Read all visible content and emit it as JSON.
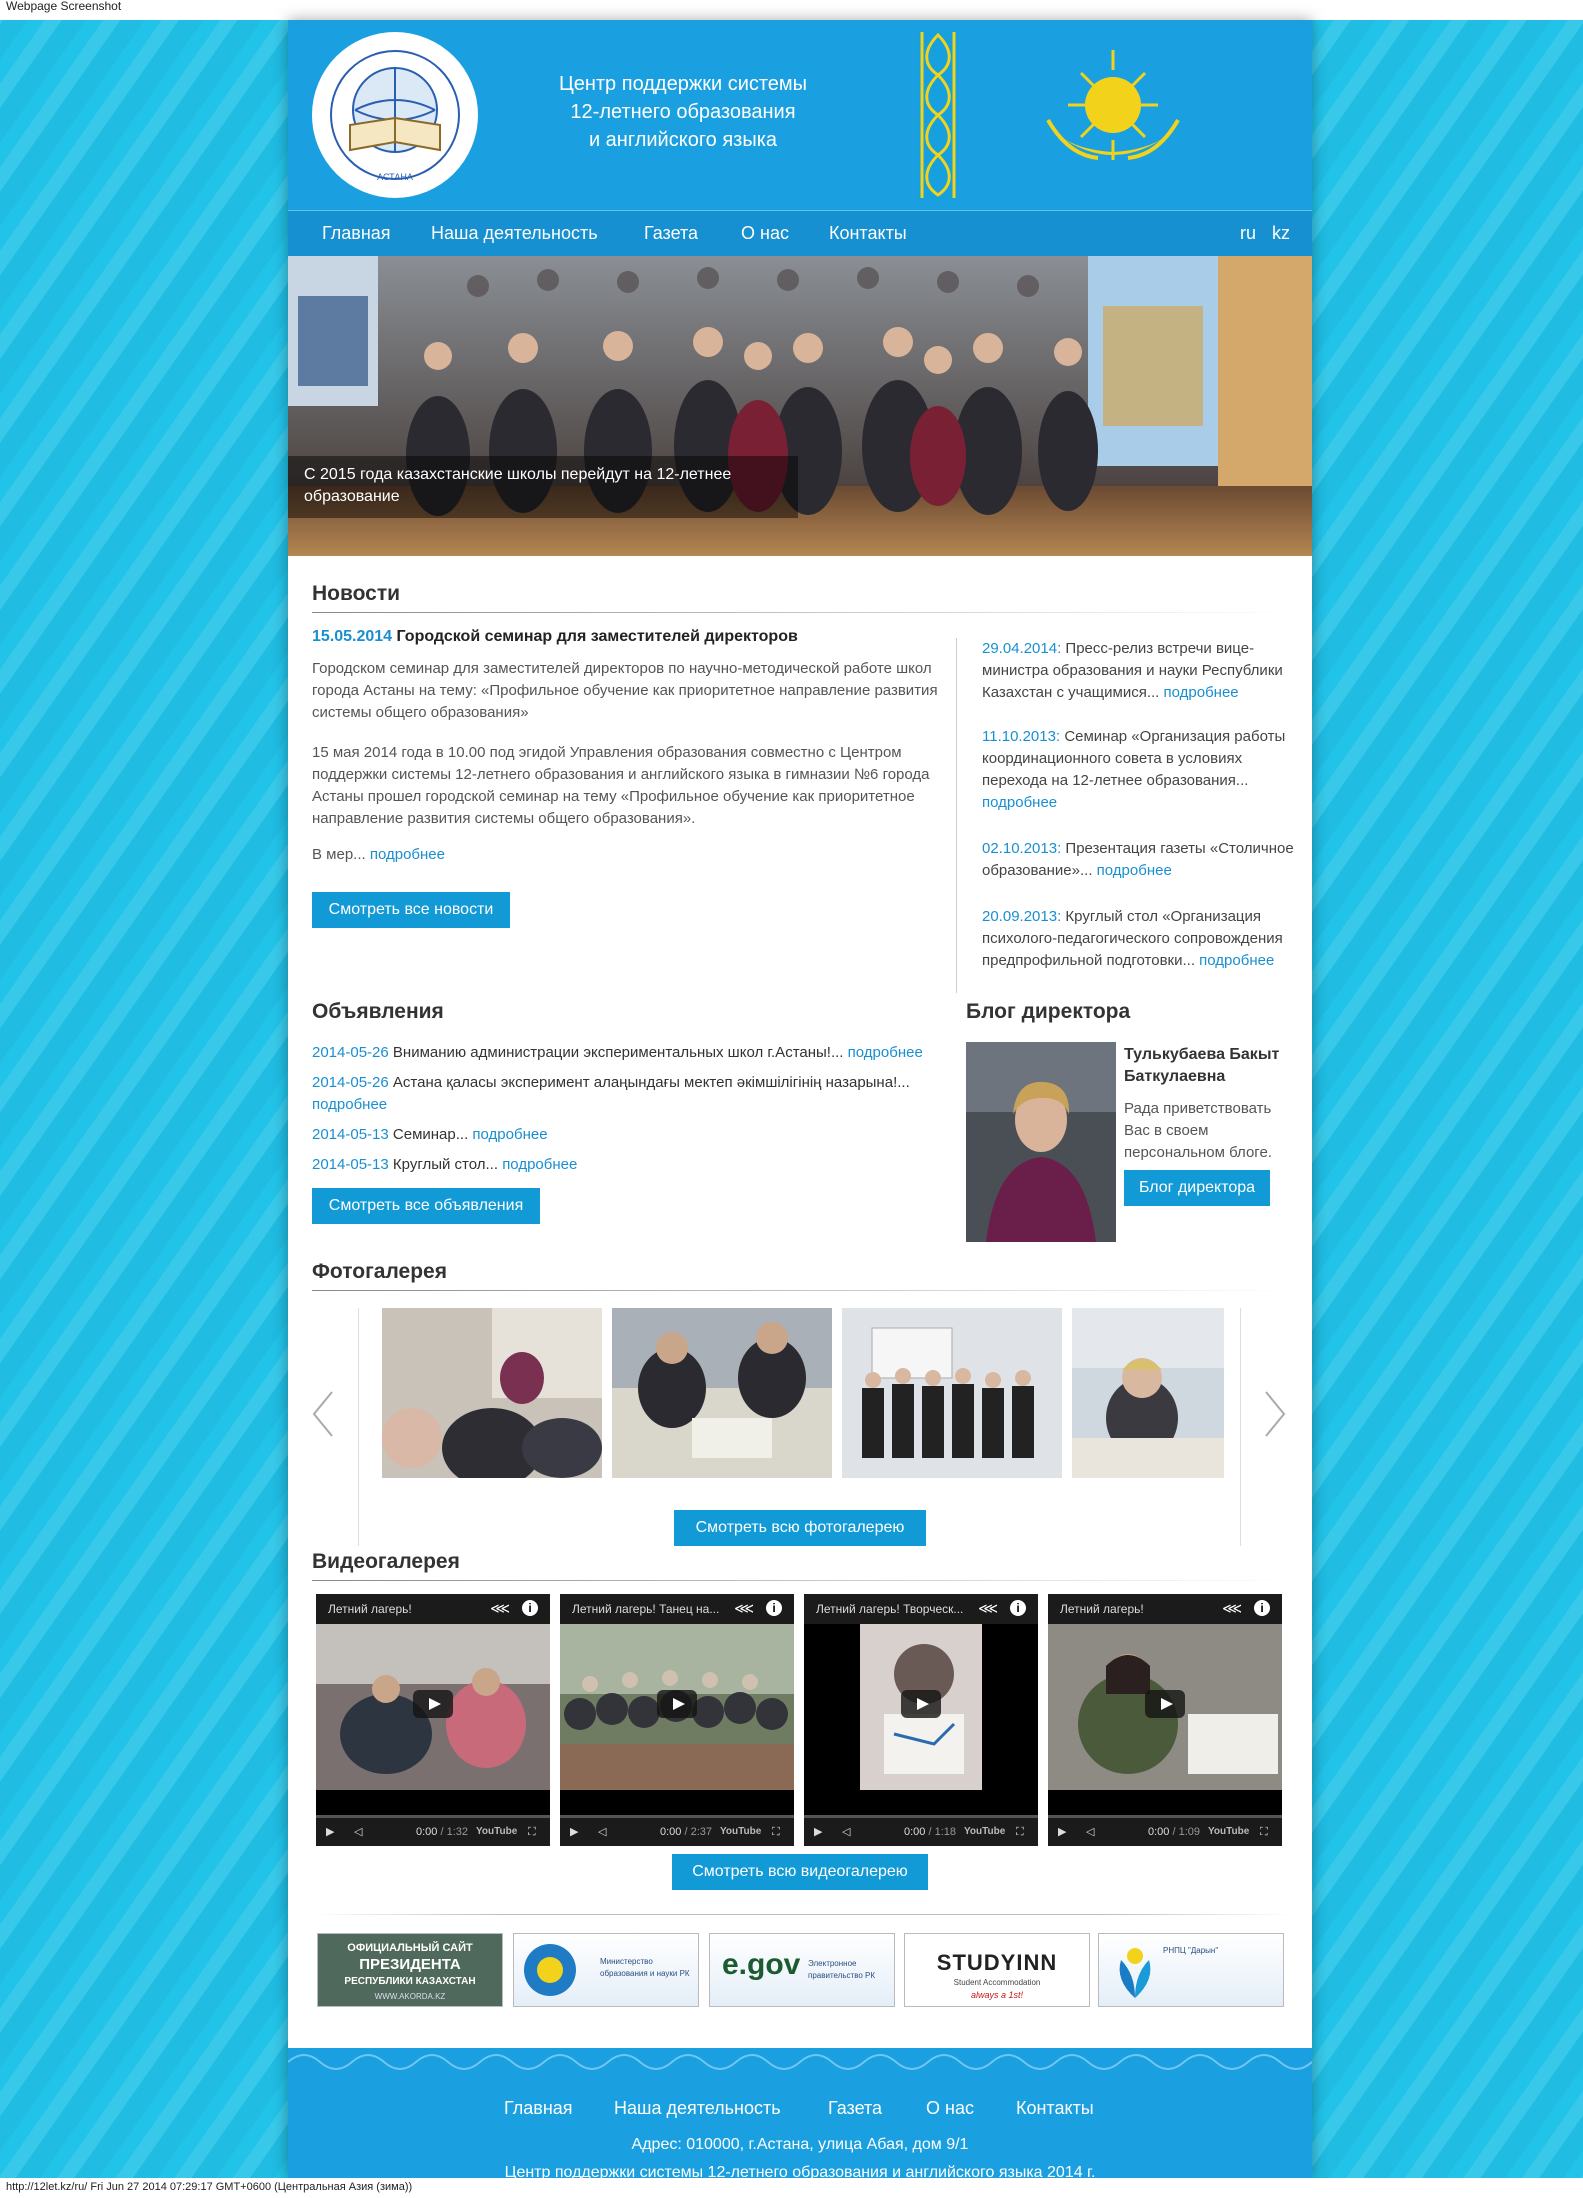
{
  "window": {
    "caption": "Webpage Screenshot",
    "status": "http://12let.kz/ru/ Fri Jun 27 2014 07:29:17 GMT+0600 (Центральная Азия (зима))"
  },
  "header": {
    "title_line1": "Центр поддержки системы",
    "title_line2": "12-летнего образования",
    "title_line3": "и английского языка",
    "logo_icon": "book-globe-logo-icon",
    "emblem_icon": "kazakhstan-emblem-icon"
  },
  "nav": {
    "items": [
      "Главная",
      "Наша деятельность",
      "Газета",
      "О нас",
      "Контакты"
    ],
    "lang_ru": "ru",
    "lang_kz": "kz"
  },
  "hero": {
    "caption": "С 2015 года казахстанские школы перейдут на 12-летнее образование"
  },
  "news": {
    "title": "Новости",
    "main": {
      "date": "15.05.2014",
      "headline": "Городской семинар для заместителей директоров",
      "p1": "Городском семинар для заместителей директоров по научно-методической работе школ города Астаны на тему: «Профильное обучение как приоритетное направление развития системы общего образования»",
      "p2": "15 мая 2014 года в 10.00 под эгидой Управления образования совместно с Центром поддержки системы 12-летнего образования и английского языка в гимназии №6 города Астаны прошел городской семинар на тему «Профильное обучение как приоритетное направление развития системы общего образования».",
      "p3": "В мер...",
      "more": "подробнее"
    },
    "all_button": "Смотреть все новости",
    "side": [
      {
        "date": "29.04.2014:",
        "text": "Пресс-релиз встречи вице-министра образования и науки Республики Казахстан с учащимися...",
        "more": "подробнее"
      },
      {
        "date": "11.10.2013:",
        "text": "Семинар «Организация работы координационного совета в условиях перехода на 12-летнее образования...",
        "more": "подробнее"
      },
      {
        "date": "02.10.2013:",
        "text": "Презентация газеты «Столичное образование»...",
        "more": "подробнее"
      },
      {
        "date": "20.09.2013:",
        "text": "Круглый стол «Организация психолого-педагогического сопровождения предпрофильной подготовки...",
        "more": "подробнее"
      }
    ]
  },
  "ads": {
    "title": "Объявления",
    "items": [
      {
        "date": "2014-05-26",
        "text": "Вниманию администрации экспериментальных школ г.Астаны!...",
        "more": "подробнее"
      },
      {
        "date": "2014-05-26",
        "text": "Астана қаласы эксперимент алаңындағы мектеп әкімшілігінің назарына!...",
        "more": "подробнее"
      },
      {
        "date": "2014-05-13",
        "text": "Семинар...",
        "more": "подробнее"
      },
      {
        "date": "2014-05-13",
        "text": "Круглый стол...",
        "more": "подробнее"
      }
    ],
    "all_button": "Смотреть все объявления"
  },
  "blog": {
    "title": "Блог директора",
    "name_line1": "Тулькубаева Бакыт",
    "name_line2": "Баткулаевна",
    "greeting": "Рада приветствовать Вас в своем персональном блоге.",
    "button": "Блог директора"
  },
  "photos": {
    "title": "Фотогалерея",
    "button": "Смотреть всю фотогалерею",
    "prev_icon": "chevron-left-icon",
    "next_icon": "chevron-right-icon"
  },
  "videos": {
    "title": "Видеогалерея",
    "button": "Смотреть всю видеогалерею",
    "items": [
      {
        "title": "Летний лагерь!",
        "time": "0:00",
        "duration": "/ 1:32"
      },
      {
        "title": "Летний лагерь! Танец на...",
        "time": "0:00",
        "duration": "/ 2:37"
      },
      {
        "title": "Летний лагерь! Творческ...",
        "time": "0:00",
        "duration": "/ 1:18"
      },
      {
        "title": "Летний лагерь!",
        "time": "0:00",
        "duration": "/ 1:09"
      }
    ],
    "yt_label": "YouTube"
  },
  "banners": {
    "president_l1": "ОФИЦИАЛЬНЫЙ САЙТ",
    "president_l2": "ПРЕЗИДЕНТА",
    "president_l3": "РЕСПУБЛИКИ КАЗАХСТАН",
    "president_l4": "WWW.AKORDA.KZ",
    "ministry": "Министерство образования и науки РК",
    "egov_logo": "e.gov",
    "egov_text": "Электронное правительство РК",
    "studyinn": "STUDYINN",
    "studyinn_sub": "Student Accommodation",
    "studyinn_tag": "always a 1st!",
    "daryn": "РНПЦ \"Дарын\""
  },
  "footer": {
    "items": [
      "Главная",
      "Наша деятельность",
      "Газета",
      "О нас",
      "Контакты"
    ],
    "address": "Адрес: 010000, г.Астана, улица Абая, дом 9/1",
    "copyright": "Центр поддержки системы 12-летнего образования и английского языка 2014 г."
  },
  "colors": {
    "background": "#22c3e8",
    "header": "#1aa0e0",
    "nav": "#1690d0",
    "accent": "#119ad6",
    "link": "#1a8fd0"
  }
}
